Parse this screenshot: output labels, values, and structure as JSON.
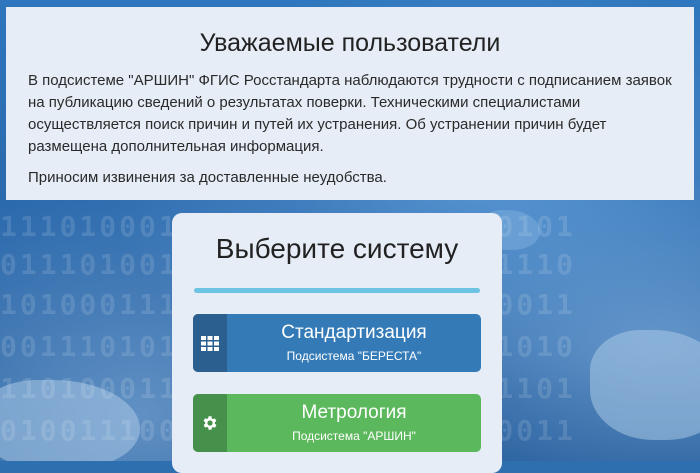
{
  "notice": {
    "title": "Уважаемые пользователи",
    "paragraph1": "В подсистеме \"АРШИН\" ФГИС Росстандарта наблюдаются трудности с подписанием заявок на публикацию сведений о результатах поверки. Техническими специалистами осуществляется поиск причин и путей их устранения. Об устранении причин будет размещена дополнительная информация.",
    "paragraph2": "Приносим извинения за доставленные неудобства."
  },
  "selector": {
    "title": "Выберите систему",
    "systems": [
      {
        "label": "Стандартизация",
        "sublabel": "Подсистема \"БЕРЕСТА\"",
        "icon": "grid-icon",
        "color": "#337ab7"
      },
      {
        "label": "Метрология",
        "sublabel": "Подсистема \"АРШИН\"",
        "icon": "gear-icon",
        "color": "#5cb85c"
      }
    ]
  }
}
